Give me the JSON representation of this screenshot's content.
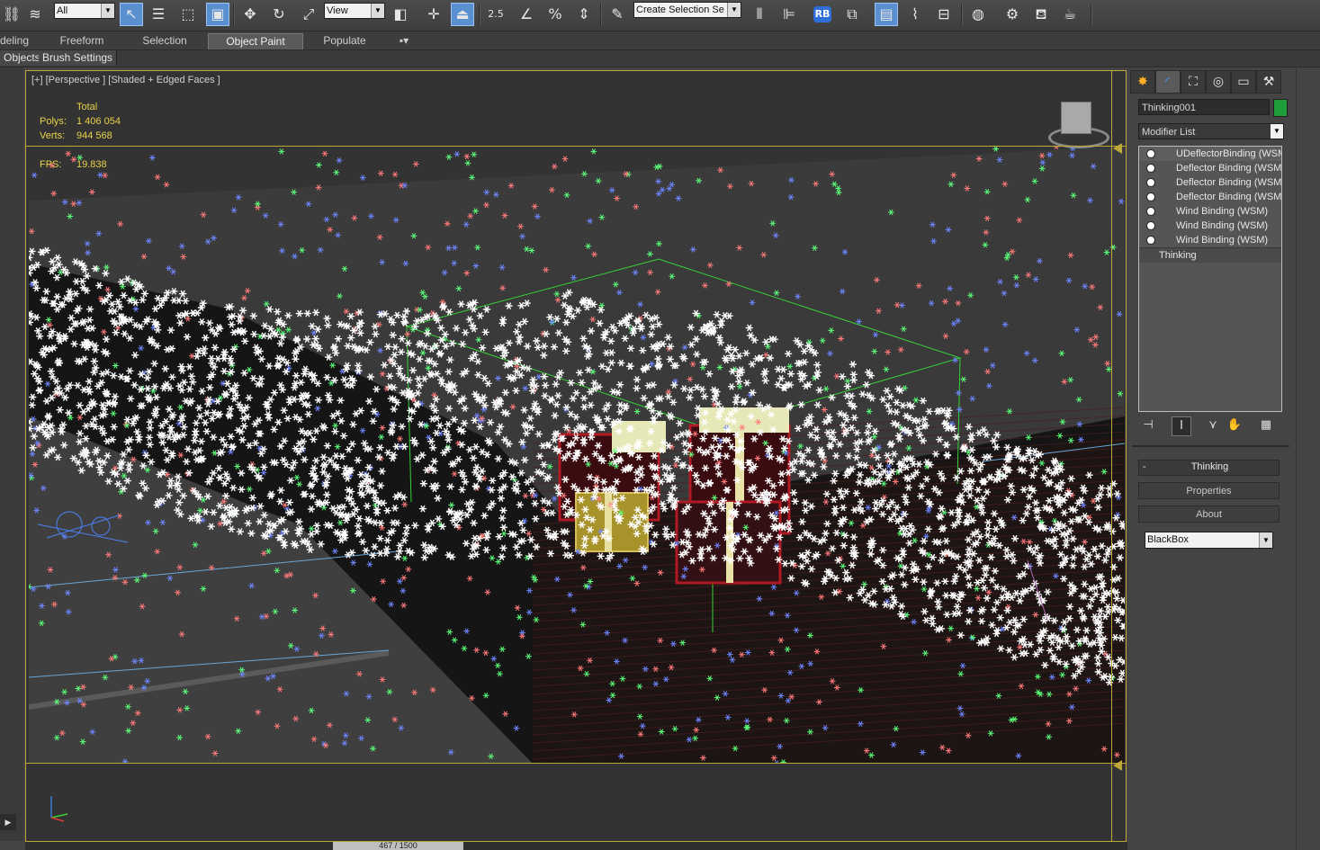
{
  "toolbar": {
    "selection_filter": "All",
    "ref_coord": "View",
    "angle_snap_label": "2.5",
    "named_selection_placeholder": "Create Selection Se"
  },
  "ribbon": {
    "tabs": [
      "deling",
      "Freeform",
      "Selection",
      "Object Paint",
      "Populate"
    ],
    "active_tab": "Object Paint",
    "subtabs": [
      "Objects",
      "Brush Settings"
    ]
  },
  "viewport": {
    "label": "[+] [Perspective ] [Shaded + Edged Faces ]",
    "stats": {
      "total_label": "Total",
      "polys_label": "Polys:",
      "polys_value": "1 406 054",
      "verts_label": "Verts:",
      "verts_value": "944 568",
      "fps_label": "FPS:",
      "fps_value": "19.838"
    }
  },
  "timeline": {
    "frame": "467 / 1500"
  },
  "command_panel": {
    "object_name": "Thinking001",
    "object_color": "#1f9e3c",
    "modifier_list": "Modifier List",
    "modifier_stack": [
      "UDeflectorBinding (WSM)",
      "Deflector Binding (WSM)",
      "Deflector Binding (WSM)",
      "Deflector Binding (WSM)",
      "Wind Binding (WSM)",
      "Wind Binding (WSM)",
      "Wind Binding (WSM)"
    ],
    "base_object": "Thinking",
    "rollout_title": "Thinking",
    "rollout_toggle": "-",
    "buttons": [
      "Properties",
      "About"
    ],
    "blackbox_value": "BlackBox"
  },
  "colors": {
    "accent": "#5a8fd0",
    "viewport_border": "#bda83a",
    "stats_text": "#e8d24a",
    "particle_white": "#ffffff",
    "particle_red": "#ff7a7a",
    "particle_green": "#5cff7a",
    "particle_blue": "#6f86ff"
  }
}
